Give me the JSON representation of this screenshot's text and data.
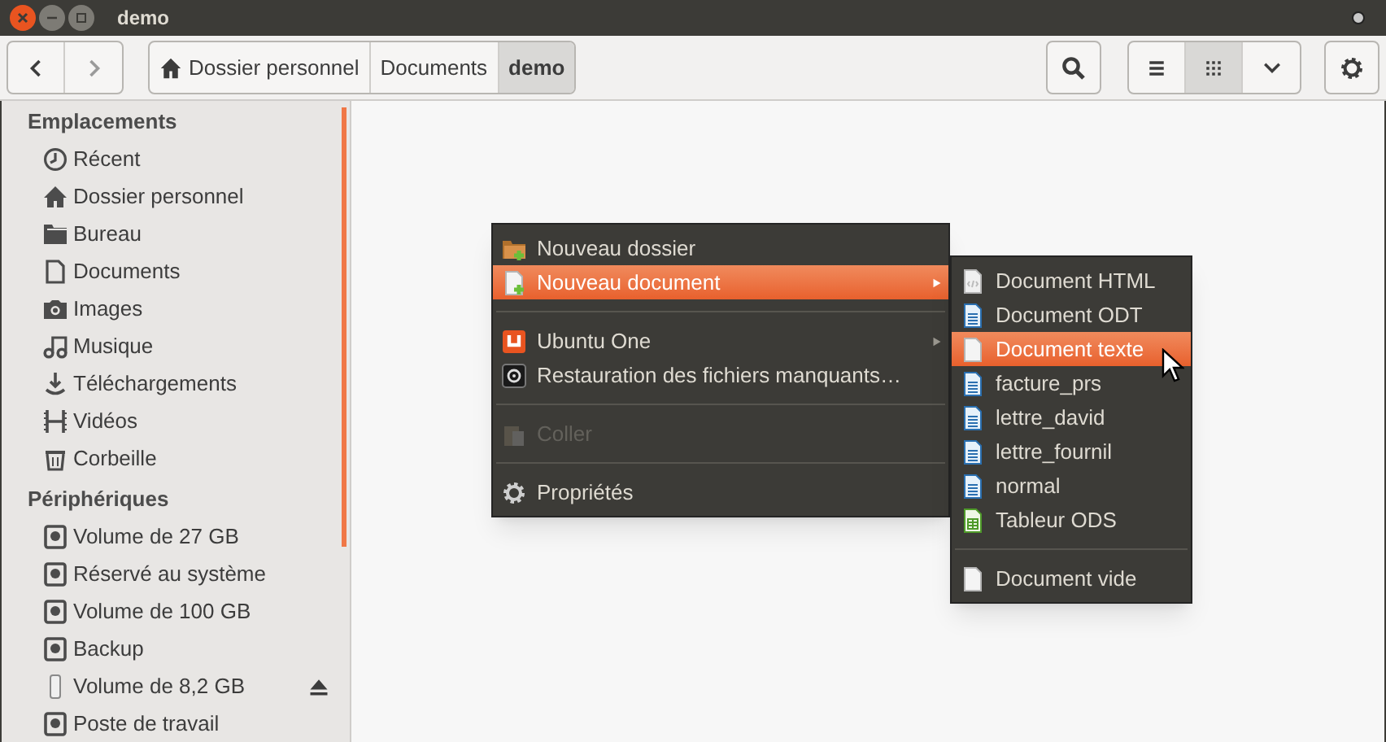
{
  "window": {
    "title": "demo"
  },
  "toolbar": {
    "path": [
      {
        "label": "Dossier personnel",
        "selected": false
      },
      {
        "label": "Documents",
        "selected": false
      },
      {
        "label": "demo",
        "selected": true
      }
    ],
    "views": [
      {
        "selected": false
      },
      {
        "selected": true
      },
      {
        "selected": false
      }
    ]
  },
  "sidebar": {
    "sections": [
      {
        "title": "Emplacements",
        "items": [
          {
            "label": "Récent",
            "ejectable": false
          },
          {
            "label": "Dossier personnel",
            "ejectable": false
          },
          {
            "label": "Bureau",
            "ejectable": false
          },
          {
            "label": "Documents",
            "ejectable": false
          },
          {
            "label": "Images",
            "ejectable": false
          },
          {
            "label": "Musique",
            "ejectable": false
          },
          {
            "label": "Téléchargements",
            "ejectable": false
          },
          {
            "label": "Vidéos",
            "ejectable": false
          },
          {
            "label": "Corbeille",
            "ejectable": false
          }
        ]
      },
      {
        "title": "Périphériques",
        "items": [
          {
            "label": "Volume de 27 GB",
            "ejectable": false
          },
          {
            "label": "Réservé au système",
            "ejectable": false
          },
          {
            "label": "Volume de 100 GB",
            "ejectable": false
          },
          {
            "label": "Backup",
            "ejectable": false
          },
          {
            "label": "Volume de 8,2 GB",
            "ejectable": true
          },
          {
            "label": "Poste de travail",
            "ejectable": false
          }
        ]
      }
    ]
  },
  "context_menu": {
    "items": [
      {
        "kind": "item",
        "label": "Nouveau dossier",
        "selected": false,
        "disabled": false,
        "submenu": false
      },
      {
        "kind": "item",
        "label": "Nouveau document",
        "selected": true,
        "disabled": false,
        "submenu": true
      },
      {
        "kind": "separator"
      },
      {
        "kind": "item",
        "label": "Ubuntu One",
        "selected": false,
        "disabled": false,
        "submenu": true
      },
      {
        "kind": "item",
        "label": "Restauration des fichiers manquants…",
        "selected": false,
        "disabled": false,
        "submenu": false
      },
      {
        "kind": "separator"
      },
      {
        "kind": "item",
        "label": "Coller",
        "selected": false,
        "disabled": true,
        "submenu": false
      },
      {
        "kind": "separator"
      },
      {
        "kind": "item",
        "label": "Propriétés",
        "selected": false,
        "disabled": false,
        "submenu": false
      }
    ]
  },
  "submenu": {
    "items": [
      {
        "kind": "item",
        "label": "Document HTML",
        "selected": false
      },
      {
        "kind": "item",
        "label": "Document ODT",
        "selected": false
      },
      {
        "kind": "item",
        "label": "Document texte",
        "selected": true
      },
      {
        "kind": "item",
        "label": "facture_prs",
        "selected": false
      },
      {
        "kind": "item",
        "label": "lettre_david",
        "selected": false
      },
      {
        "kind": "item",
        "label": "lettre_fournil",
        "selected": false
      },
      {
        "kind": "item",
        "label": "normal",
        "selected": false
      },
      {
        "kind": "item",
        "label": "Tableur ODS",
        "selected": false
      },
      {
        "kind": "separator"
      },
      {
        "kind": "item",
        "label": "Document vide",
        "selected": false
      }
    ]
  }
}
